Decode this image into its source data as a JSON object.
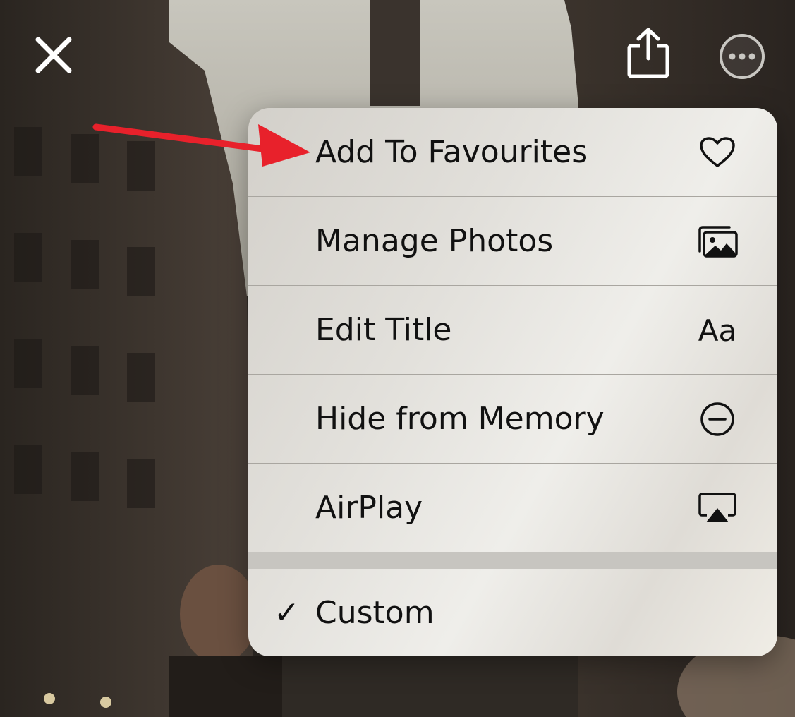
{
  "toolbar": {
    "close_icon": "close-icon",
    "share_icon": "share-icon",
    "more_icon": "ellipsis-circle-icon"
  },
  "menu": {
    "items": [
      {
        "label": "Add To Favourites",
        "icon": "heart-icon"
      },
      {
        "label": "Manage Photos",
        "icon": "photos-stack-icon"
      },
      {
        "label": "Edit Title",
        "icon_text": "Aa"
      },
      {
        "label": "Hide from Memory",
        "icon": "minus-circle-icon"
      },
      {
        "label": "AirPlay",
        "icon": "airplay-icon"
      }
    ],
    "selection": {
      "label": "Custom",
      "checkmark": "✓"
    }
  },
  "annotation": {
    "arrow_color": "#e8212b"
  },
  "colors": {
    "menu_text": "#111111",
    "icon_white": "#ffffff"
  }
}
